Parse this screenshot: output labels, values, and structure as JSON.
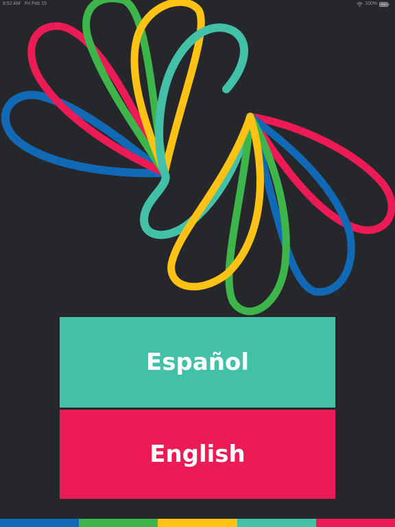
{
  "status_bar": {
    "time": "8:52 AM",
    "date": "Fri Feb 15",
    "battery": "100%"
  },
  "buttons": {
    "spanish_label": "Español",
    "english_label": "English"
  },
  "colors": {
    "background": "#26272b",
    "teal": "#43c1a8",
    "red": "#ec1a55",
    "green": "#3db54a",
    "yellow": "#fec214",
    "blue": "#1169b6"
  },
  "logo": {
    "icon": "flower-swirl-logo-icon"
  }
}
